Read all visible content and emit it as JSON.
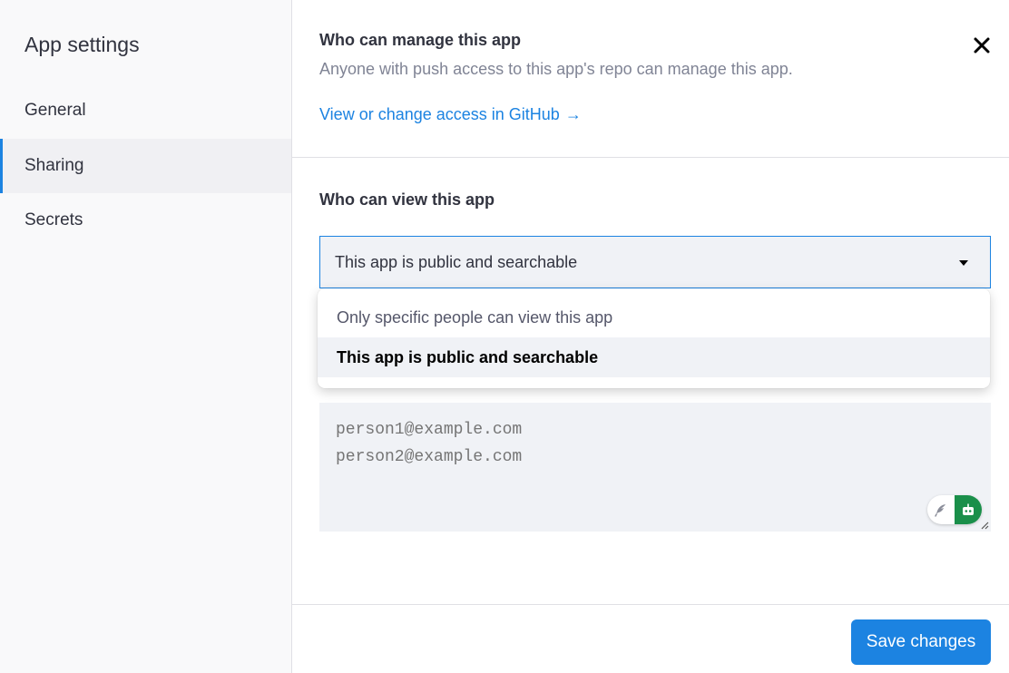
{
  "sidebar": {
    "title": "App settings",
    "items": [
      {
        "label": "General",
        "active": false
      },
      {
        "label": "Sharing",
        "active": true
      },
      {
        "label": "Secrets",
        "active": false
      }
    ]
  },
  "manage": {
    "title": "Who can manage this app",
    "description": "Anyone with push access to this app's repo can manage this app.",
    "link_label": "View or change access in GitHub",
    "link_arrow": "→"
  },
  "view": {
    "title": "Who can view this app",
    "selected_value": "This app is public and searchable",
    "options": [
      {
        "label": "Only specific people can view this app",
        "selected": false
      },
      {
        "label": "This app is public and searchable",
        "selected": true
      }
    ]
  },
  "emails": {
    "placeholder": "person1@example.com\nperson2@example.com"
  },
  "footer": {
    "save_label": "Save changes"
  },
  "icons": {
    "close": "close-icon",
    "caret": "caret-down-icon",
    "link_arrow": "arrow-right-icon",
    "feather": "feather-icon",
    "bot": "bot-icon",
    "resize": "resize-grip-icon"
  },
  "colors": {
    "accent": "#1c83e1",
    "text": "#31333f",
    "muted": "#808495",
    "sidebar_bg": "#f9f9fa",
    "input_bg": "#f0f2f6",
    "bot_green": "#1a8f4a"
  }
}
